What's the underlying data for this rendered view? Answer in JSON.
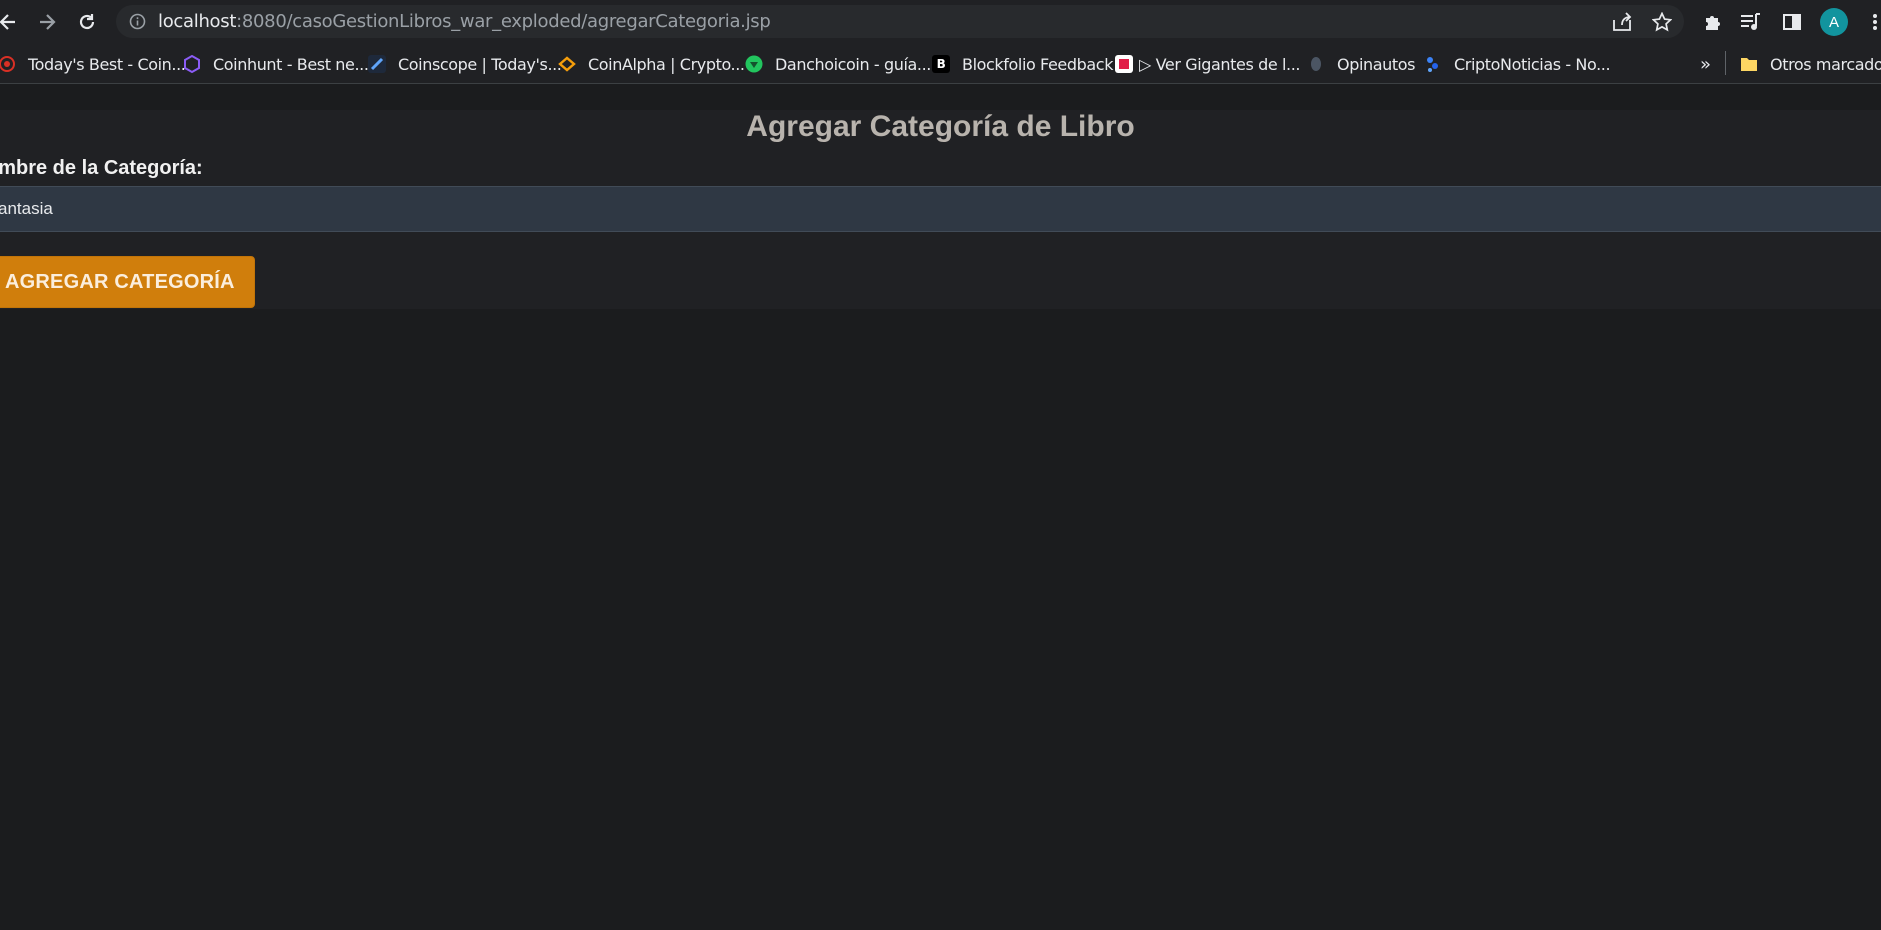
{
  "browser": {
    "url_host": "localhost",
    "url_rest": ":8080/casoGestionLibros_war_exploded/agregarCategoria.jsp",
    "avatar_letter": "A",
    "bookmarks": [
      {
        "label": "Today's Best - Coin...",
        "icon": "red-gear-icon",
        "color": "#d93025"
      },
      {
        "label": "Coinhunt - Best ne...",
        "icon": "purple-hexagon-icon",
        "color": "#8b5cf6"
      },
      {
        "label": "Coinscope | Today's...",
        "icon": "coinscope-icon",
        "color": "#3b82f6"
      },
      {
        "label": "CoinAlpha | Crypto...",
        "icon": "coinalpha-icon",
        "color": "#f59e0b"
      },
      {
        "label": "Danchoicoin - guía...",
        "icon": "green-circle-icon",
        "color": "#22c55e"
      },
      {
        "label": "Blockfolio Feedback",
        "icon": "b-letter-icon",
        "color": "#000000"
      },
      {
        "label": "▷ Ver Gigantes de l...",
        "icon": "gigantes-icon",
        "color": "#e11d48"
      },
      {
        "label": "Opinautos",
        "icon": "opinautos-icon",
        "color": "#6b7280"
      },
      {
        "label": "CriptoNoticias - No...",
        "icon": "criptonoticias-icon",
        "color": "#3b82f6"
      }
    ],
    "overflow_label": "»",
    "other_bookmarks": "Otros marcadores"
  },
  "page": {
    "title": "Agregar Categoría de Libro",
    "field_label": "ombre de la Categoría:",
    "field_value": "antasia",
    "submit_label": "AGREGAR CATEGORÍA"
  },
  "colors": {
    "accent_button": "#d07e0c",
    "input_bg": "#2f3844",
    "page_bg": "#1b1c1e"
  }
}
